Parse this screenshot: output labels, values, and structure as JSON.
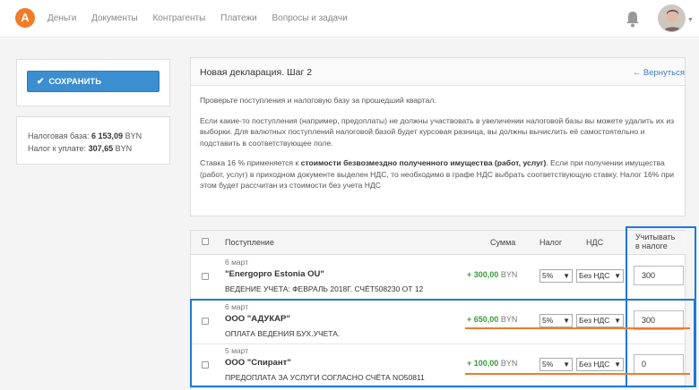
{
  "brand": {
    "logo_letter": "A",
    "accent": "#f07b28"
  },
  "nav": {
    "items": [
      "Деньги",
      "Документы",
      "Контрагенты",
      "Платежи",
      "Вопросы и задачи"
    ]
  },
  "sidebar": {
    "save_label": "СОХРАНИТЬ",
    "tax_base_label": "Налоговая база:",
    "tax_base_value": "6 153,09",
    "tax_base_currency": "BYN",
    "tax_due_label": "Налог к уплате:",
    "tax_due_value": "307,65",
    "tax_due_currency": "BYN"
  },
  "panel": {
    "title": "Новая декларация. Шаг 2",
    "back_label": "← Вернуться",
    "p1": "Проверьте поступления и налоговую базу за прошедший квартал.",
    "p2": "Если какие-то поступления (например, предоплаты) не должны участвовать в увеличении налоговой базы вы можете удалить их из выборки. Для валютных поступлений налоговой базой будет курсовая разница, вы должны вычислить её самостоятельно и подставить в соответствующее поле.",
    "p3a": "Ставка 16 % применяется к ",
    "p3b": "стоимости безвозмездно полученного имущества (работ, услуг)",
    "p3c": ". Если при получении имущества (работ, услуг) в приходном документе выделен НДС, то необходимо в графе НДС выбрать соответствующую ставку. Налог 16% при этом будет рассчитан из стоимости без учета НДС"
  },
  "table": {
    "headers": {
      "income": "Поступление",
      "amount": "Сумма",
      "tax": "Налог",
      "vat": "НДС",
      "include_line1": "Учитывать",
      "include_line2": "в налоге"
    },
    "rows": [
      {
        "date": "6 март",
        "party": "\"Energopro Estonia OU\"",
        "desc": "ВЕДЕНИЕ УЧЕТА: ФЕВРАЛЬ 2018Г. СЧЁТ508230 ОТ 12",
        "amount": "+ 300,00",
        "currency": "BYN",
        "tax": "5%",
        "vat": "Без НДС",
        "include": "300"
      },
      {
        "date": "6 март",
        "party": "ООО \"АДУКАР\"",
        "desc": "ОПЛАТА ВЕДЕНИЯ БУХ.УЧЕТА.",
        "amount": "+ 650,00",
        "currency": "BYN",
        "tax": "5%",
        "vat": "Без НДС",
        "include": "300"
      },
      {
        "date": "5 март",
        "party": "ООО \"Спирант\"",
        "desc": "ПРЕДОПЛАТА ЗА УСЛУГИ СОГЛАСНО СЧЁТА NO50811",
        "amount": "+ 100,00",
        "currency": "BYN",
        "tax": "5%",
        "vat": "Без НДС",
        "include": "0"
      }
    ]
  },
  "icons": {
    "bell": "bell-icon",
    "check": "check-icon",
    "dropdown": "chevron-down-icon"
  }
}
